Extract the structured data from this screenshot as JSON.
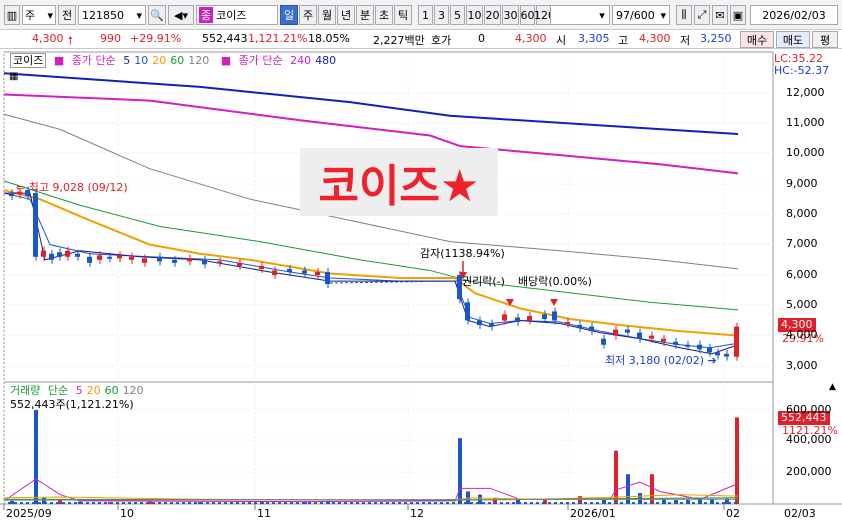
{
  "toolbar": {
    "market_select": "주",
    "view_label": "전",
    "code": "121850",
    "stock_badge": "종",
    "stock_name": "코이즈",
    "period_tabs": [
      "일",
      "주",
      "월",
      "년",
      "분",
      "초",
      "틱"
    ],
    "interval_tabs": [
      "1",
      "3",
      "5",
      "10",
      "20",
      "30",
      "60",
      "120"
    ],
    "count": "97/600",
    "date": "2026/02/03"
  },
  "quote": {
    "price": "4,300",
    "change": "990",
    "change_pct": "+29.91%",
    "volume": "552,443",
    "volume_pct": "1,121.21%",
    "turnover": "18.05%",
    "amount": "2,227백만",
    "hoga_label": "호가",
    "hoga_value": "0",
    "hoga_price": "4,300",
    "open_label": "시",
    "open": "3,305",
    "high_label": "고",
    "high": "4,300",
    "low_label": "저",
    "low": "3,250",
    "buy_label": "매수",
    "sell_label": "매도",
    "eval_label": "평"
  },
  "price_panel": {
    "legend_name": "코이즈",
    "legend_ma_label": "종가 단순",
    "legend_ma_periods": [
      "5",
      "10",
      "20",
      "60",
      "120"
    ],
    "legend_ma2_label": "종가 단순",
    "legend_ma2_periods": [
      "240",
      "480"
    ],
    "lc": "LC:35.22",
    "hc": "HC:-52.37",
    "title": "코이즈★",
    "max_label": "최고 9,028 (09/12)",
    "min_label": "최저 3,180 (02/02)",
    "split_label": "감자(1138.94%)",
    "rights_label": "권리락(-)",
    "dividend_label": "배당락(0.00%)",
    "price_tag": "4,300",
    "pct_tag": "29.91%",
    "y_ticks": [
      "12,000",
      "11,000",
      "10,000",
      "9,000",
      "8,000",
      "7,000",
      "6,000",
      "5,000",
      "4,000",
      "3,000"
    ]
  },
  "volume_panel": {
    "legend_name": "거래량",
    "legend_ma_label": "단순",
    "legend_ma_periods": [
      "5",
      "20",
      "60",
      "120"
    ],
    "volume_label": "552,443주(1,121.21%)",
    "vol_tag": "552,443",
    "vol_pct_tag": "1121.21%",
    "y_ticks": [
      "600,000",
      "400,000",
      "200,000"
    ]
  },
  "x_axis": [
    "2025/09",
    "10",
    "11",
    "12",
    "2026/01",
    "02",
    "02/03"
  ],
  "colors": {
    "up": "#e0202a",
    "down": "#1a56c8",
    "ma5": "#1b1b8f",
    "ma10": "#1a56c8",
    "ma20": "#f0a000",
    "ma60": "#1a9a3a",
    "ma120": "#808080",
    "ma240": "#d020c0",
    "ma480": "#1020c0"
  },
  "chart_data": {
    "type": "candlestick",
    "x": [
      "2025/09",
      "2025/10",
      "2025/11",
      "2025/12",
      "2026/01",
      "2026/02/02",
      "2026/02/03"
    ],
    "close": [
      8700,
      6600,
      6000,
      4500,
      4100,
      3310,
      4300
    ],
    "ylim": [
      3000,
      12500
    ],
    "max": {
      "value": 9028,
      "date": "09/12"
    },
    "min": {
      "value": 3180,
      "date": "02/02"
    },
    "last": {
      "close": 4300,
      "open": 3305,
      "high": 4300,
      "low": 3250,
      "volume": 552443
    }
  }
}
